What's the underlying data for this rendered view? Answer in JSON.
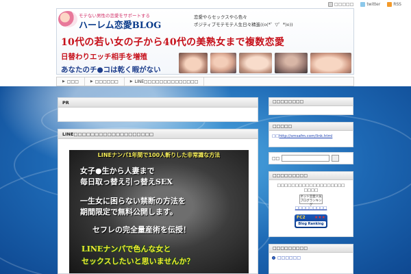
{
  "toplinks": [
    {
      "label": "□□□□□",
      "icon": "bookmark-icon"
    },
    {
      "label": "twitter",
      "icon": "twitter-icon"
    },
    {
      "label": "RSS",
      "icon": "rss-icon"
    }
  ],
  "header": {
    "logo_sub": "モテない男性の恋愛をサポートする",
    "logo_title": "ハーレム恋愛BLOG",
    "tagline1": "恋愛やらセックスやら色々",
    "tagline2": "ポジティブモテモテ人生日々精進((o(*゜▽゜*)o))",
    "headline": "10代の若い女の子から40代の美熟女まで複数恋愛",
    "sub1": "日替わりエッチ相手を増殖",
    "sub2": "あなたのチ●コは乾く暇がない"
  },
  "nav": {
    "items": [
      "□□□",
      "□□□□□□",
      "LINE□□□□□□□□□□□□□□"
    ]
  },
  "main": {
    "pr_title": "PR",
    "post_title": "LINE□□□□□□□□□□□□□□□□□□□",
    "ad": {
      "top": "LINEナンパ1年間で100人斬りした非常識な方法",
      "line1": "女子●生から人妻まで",
      "line2": "毎日取っ替え引っ替えSEX",
      "line3": "一生女に困らない禁断の方法を",
      "line4": "期間限定で無料公開します。",
      "line5": "セフレの完全量産術を伝授！",
      "cta1": "LINEナンパで色んな女と",
      "cta2": "セックスしたいと思いませんか？"
    }
  },
  "sidebar": {
    "box1_title": "□□□□□□□□",
    "box2_title": "□□□□□",
    "link_prefix": "□□",
    "link_url": "http://smsafm.com/link.html",
    "search_label": "□□",
    "box3_title": "□□□□□□□□□",
    "rank_line1": "□□□□□□□□□□□□□□□□□□□",
    "rank_line2": "□□□□",
    "rank_badge": "ネット恋愛人気ブログランキング",
    "rank_link": "□□□□□□□□□",
    "fc2_top": "FC2",
    "fc2_stars": "★★★",
    "fc2_bottom": "Blog Ranking",
    "box4_title": "□□□□□□□□□",
    "list_item": "□□□□□□"
  }
}
